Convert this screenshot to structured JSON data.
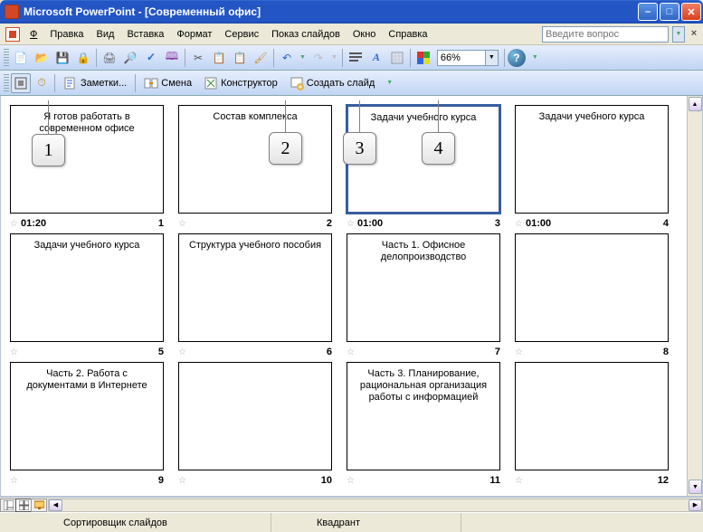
{
  "window": {
    "title": "Microsoft PowerPoint - [Современный офис]"
  },
  "menu": {
    "file": "Файл",
    "edit": "Правка",
    "view": "Вид",
    "insert": "Вставка",
    "format": "Формат",
    "tools": "Сервис",
    "slideshow": "Показ слайдов",
    "window": "Окно",
    "help": "Справка",
    "ask_placeholder": "Введите вопрос"
  },
  "toolbar": {
    "zoom": "66%"
  },
  "toolbar2": {
    "notes": "Заметки...",
    "transition": "Смена",
    "design": "Конструктор",
    "new_slide": "Создать слайд"
  },
  "callouts": {
    "c1": "1",
    "c2": "2",
    "c3": "3",
    "c4": "4"
  },
  "slides": [
    {
      "title": "Я готов работать в современном офисе",
      "timing": "01:20",
      "num": "1"
    },
    {
      "title": "Состав комплекса",
      "timing": "",
      "num": "2"
    },
    {
      "title": "Задачи учебного курса",
      "timing": "01:00",
      "num": "3",
      "selected": true
    },
    {
      "title": "Задачи учебного курса",
      "timing": "01:00",
      "num": "4"
    },
    {
      "title": "Задачи учебного курса",
      "timing": "",
      "num": "5"
    },
    {
      "title": "Структура учебного пособия",
      "timing": "",
      "num": "6"
    },
    {
      "title": "Часть 1. Офисное делопроизводство",
      "timing": "",
      "num": "7"
    },
    {
      "title": "",
      "timing": "",
      "num": "8"
    },
    {
      "title": "Часть 2. Работа с документами в Интернете",
      "timing": "",
      "num": "9"
    },
    {
      "title": "",
      "timing": "",
      "num": "10"
    },
    {
      "title": "Часть 3. Планирование, рациональная организация работы с информацией",
      "timing": "",
      "num": "11"
    },
    {
      "title": "",
      "timing": "",
      "num": "12"
    }
  ],
  "status": {
    "mode": "Сортировщик слайдов",
    "design": "Квадрант"
  }
}
